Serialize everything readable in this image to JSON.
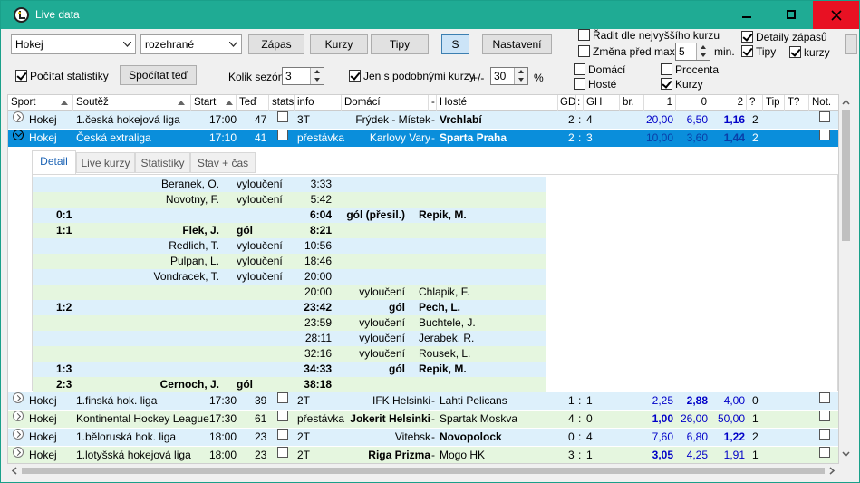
{
  "window": {
    "title": "Live data",
    "minimize_icon": "minimize-icon",
    "maximize_icon": "maximize-icon",
    "close_icon": "close-icon"
  },
  "toolbar": {
    "sport_combo": "Hokej",
    "state_combo": "rozehrané",
    "btn_zapas": "Zápas",
    "btn_kurzy": "Kurzy",
    "btn_tipy": "Tipy",
    "btn_s": "S",
    "btn_nastaveni": "Nastavení",
    "radit_label": "Řadit dle nejvyššího kurzu",
    "zmena_label": "Změna před max.",
    "zmena_value": "5",
    "zmena_unit": "min.",
    "detaily_label": "Detaily zápasů",
    "tipy_label": "Tipy",
    "kurzy_label": "kurzy",
    "pocitat_label": "Počítat statistiky",
    "spocitat_btn": "Spočítat teď",
    "kolik_label": "Kolik sezón",
    "kolik_value": "3",
    "jen_label": "Jen s podobnými kurzy",
    "pm_label": "+/-",
    "pm_value": "30",
    "pct_label": "%",
    "domaci_label": "Domácí",
    "hoste_label": "Hosté",
    "procenta_label": "Procenta",
    "kurzy2_label": "Kurzy"
  },
  "columns": [
    "Sport",
    "Soutěž",
    "Start",
    "Teď",
    "stats",
    "info",
    "Domácí",
    "-",
    "Hosté",
    "GD",
    ":",
    "GH",
    "br.",
    "1",
    "0",
    "2",
    "?",
    "Tip",
    "T?",
    "Not."
  ],
  "rows_top": [
    {
      "sport": "Hokej",
      "league": "1.česká hokejová liga",
      "start": "17:00",
      "now": "47",
      "info": "3T",
      "home": "Frýdek - Místek",
      "sep": "-",
      "away": "Vrchlabí",
      "gd": "2",
      "gh": "4",
      "o1": "20,00",
      "o0": "6,50",
      "o2": "1,16",
      "q": "2"
    },
    {
      "sport": "Hokej",
      "league": "Česká extraliga",
      "start": "17:10",
      "now": "41",
      "info": "přestávka",
      "home": "Karlovy Vary",
      "sep": "-",
      "away": "Sparta Praha",
      "gd": "2",
      "gh": "3",
      "o1": "10,00",
      "o0": "3,60",
      "o2": "1,44",
      "q": "2"
    }
  ],
  "detail_tabs": [
    "Detail",
    "Live kurzy",
    "Statistiky",
    "Stav + čas"
  ],
  "events": [
    {
      "score": "",
      "hplayer": "Beranek, O.",
      "htype": "vyloučení",
      "time": "3:33",
      "atype": "",
      "aplayer": "",
      "bold": false
    },
    {
      "score": "",
      "hplayer": "Novotny, F.",
      "htype": "vyloučení",
      "time": "5:42",
      "atype": "",
      "aplayer": "",
      "bold": false
    },
    {
      "score": "0:1",
      "hplayer": "",
      "htype": "",
      "time": "6:04",
      "atype": "gól (přesil.)",
      "aplayer": "Repik, M.",
      "bold": true
    },
    {
      "score": "1:1",
      "hplayer": "Flek, J.",
      "htype": "gól",
      "time": "8:21",
      "atype": "",
      "aplayer": "",
      "bold": true
    },
    {
      "score": "",
      "hplayer": "Redlich, T.",
      "htype": "vyloučení",
      "time": "10:56",
      "atype": "",
      "aplayer": "",
      "bold": false
    },
    {
      "score": "",
      "hplayer": "Pulpan, L.",
      "htype": "vyloučení",
      "time": "18:46",
      "atype": "",
      "aplayer": "",
      "bold": false
    },
    {
      "score": "",
      "hplayer": "Vondracek, T.",
      "htype": "vyloučení",
      "time": "20:00",
      "atype": "",
      "aplayer": "",
      "bold": false
    },
    {
      "score": "",
      "hplayer": "",
      "htype": "",
      "time": "20:00",
      "atype": "vyloučení",
      "aplayer": "Chlapik, F.",
      "bold": false
    },
    {
      "score": "1:2",
      "hplayer": "",
      "htype": "",
      "time": "23:42",
      "atype": "gól",
      "aplayer": "Pech, L.",
      "bold": true
    },
    {
      "score": "",
      "hplayer": "",
      "htype": "",
      "time": "23:59",
      "atype": "vyloučení",
      "aplayer": "Buchtele, J.",
      "bold": false
    },
    {
      "score": "",
      "hplayer": "",
      "htype": "",
      "time": "28:11",
      "atype": "vyloučení",
      "aplayer": "Jerabek, R.",
      "bold": false
    },
    {
      "score": "",
      "hplayer": "",
      "htype": "",
      "time": "32:16",
      "atype": "vyloučení",
      "aplayer": "Rousek, L.",
      "bold": false
    },
    {
      "score": "1:3",
      "hplayer": "",
      "htype": "",
      "time": "34:33",
      "atype": "gól",
      "aplayer": "Repik, M.",
      "bold": true
    },
    {
      "score": "2:3",
      "hplayer": "Cernoch, J.",
      "htype": "gól",
      "time": "38:18",
      "atype": "",
      "aplayer": "",
      "bold": true
    }
  ],
  "rows_bottom": [
    {
      "sport": "Hokej",
      "league": "1.finská hok. liga",
      "start": "17:30",
      "now": "39",
      "info": "2T",
      "home": "IFK Helsinki",
      "sep": "-",
      "away": "Lahti Pelicans",
      "gd": "1",
      "gh": "1",
      "o1": "2,25",
      "o0": "2,88",
      "o2": "4,00",
      "q": "0"
    },
    {
      "sport": "Hokej",
      "league": "Kontinental Hockey League",
      "start": "17:30",
      "now": "61",
      "info": "přestávka",
      "home": "Jokerit Helsinki",
      "sep": "-",
      "away": "Spartak Moskva",
      "gd": "4",
      "gh": "0",
      "o1": "1,00",
      "o0": "26,00",
      "o2": "50,00",
      "q": "1"
    },
    {
      "sport": "Hokej",
      "league": "1.běloruská hok. liga",
      "start": "18:00",
      "now": "23",
      "info": "2T",
      "home": "Vitebsk",
      "sep": "-",
      "away": "Novopolock",
      "gd": "0",
      "gh": "4",
      "o1": "7,60",
      "o0": "6,80",
      "o2": "1,22",
      "q": "2"
    },
    {
      "sport": "Hokej",
      "league": "1.lotyšská hokejová liga",
      "start": "18:00",
      "now": "23",
      "info": "2T",
      "home": "Riga Prizma",
      "sep": "-",
      "away": "Mogo HK",
      "gd": "3",
      "gh": "1",
      "o1": "3,05",
      "o0": "4,25",
      "o2": "1,91",
      "q": "1"
    }
  ]
}
